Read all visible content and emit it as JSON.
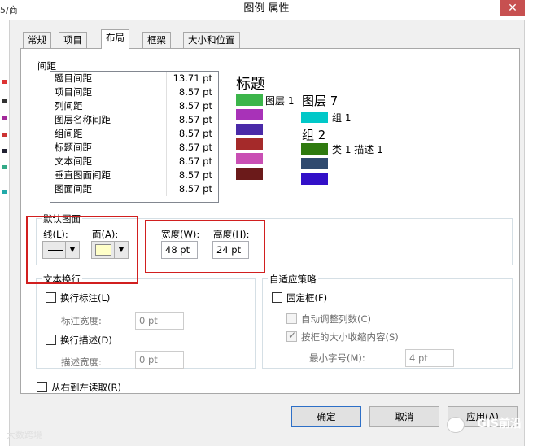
{
  "window": {
    "title": "图例 属性",
    "title_fragment": "5/商",
    "close_glyph": "✕"
  },
  "tabs": [
    {
      "label": "常规"
    },
    {
      "label": "项目"
    },
    {
      "label": "布局",
      "active": true
    },
    {
      "label": "框架"
    },
    {
      "label": "大小和位置"
    }
  ],
  "spacing": {
    "label": "间距",
    "rows": [
      {
        "name": "题目间距",
        "value": "13.71 pt"
      },
      {
        "name": "项目间距",
        "value": "8.57 pt"
      },
      {
        "name": "列间距",
        "value": "8.57 pt"
      },
      {
        "name": "图层名称间距",
        "value": "8.57 pt"
      },
      {
        "name": "组间距",
        "value": "8.57 pt"
      },
      {
        "name": "标题间距",
        "value": "8.57 pt"
      },
      {
        "name": "文本间距",
        "value": "8.57 pt"
      },
      {
        "name": "垂直图面间距",
        "value": "8.57 pt"
      },
      {
        "name": "图面间距",
        "value": "8.57 pt"
      }
    ]
  },
  "preview": {
    "title": "标题",
    "layer1": "图层 1",
    "layer7": "图层 7",
    "group1": "组 1",
    "group2": "组 2",
    "class_desc": "类 1 描述 1",
    "colors": {
      "c1": "#3cb54b",
      "c2": "#a832b8",
      "c3": "#4a2aa8",
      "c4": "#a52a2a",
      "c5": "#c94fb4",
      "c6": "#6b1a1a",
      "c7": "#00c8c8",
      "c8": "#2f7a0f",
      "c9": "#2f4a6e",
      "c10": "#3210c8"
    }
  },
  "default_patch": {
    "label": "默认图面",
    "line_label": "线(L):",
    "fill_label": "面(A):",
    "width_label": "宽度(W):",
    "width_value": "48 pt",
    "height_label": "高度(H):",
    "height_value": "24 pt",
    "fill_color": "#ffffc8"
  },
  "text_wrap": {
    "label": "文本换行",
    "wrap_label_cb": "换行标注(L)",
    "label_width": "标注宽度:",
    "label_width_value": "0 pt",
    "wrap_desc_cb": "换行描述(D)",
    "desc_width": "描述宽度:",
    "desc_width_value": "0 pt"
  },
  "fit": {
    "label": "自适应策略",
    "fixed_frame": "固定框(F)",
    "auto_cols": "自动调整列数(C)",
    "shrink": "按框的大小收缩内容(S)",
    "min_font": "最小字号(M):",
    "min_font_value": "4 pt"
  },
  "rtl": "从右到左读取(R)",
  "buttons": {
    "ok": "确定",
    "cancel": "取消",
    "apply": "应用(A)"
  },
  "watermarks": {
    "left": "大数跨境",
    "right": "GIS前沿"
  }
}
